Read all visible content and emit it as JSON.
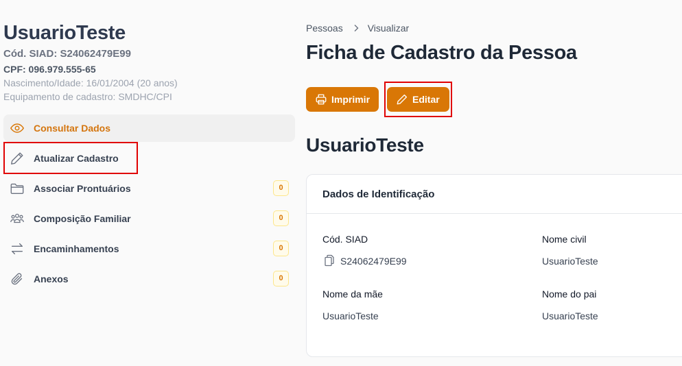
{
  "person": {
    "name": "UsuarioTeste",
    "siad": "Cód. SIAD: S24062479E99",
    "cpf": "CPF: 096.979.555-65",
    "birth": "Nascimento/Idade: 16/01/2004 (20 anos)",
    "equipment": "Equipamento de cadastro: SMDHC/CPI"
  },
  "menu": [
    {
      "label": "Consultar Dados",
      "icon": "eye-icon",
      "active": true
    },
    {
      "label": "Atualizar Cadastro",
      "icon": "pencil-icon"
    },
    {
      "label": "Associar Prontuários",
      "icon": "folder-icon",
      "count": "0"
    },
    {
      "label": "Composição Familiar",
      "icon": "users-icon",
      "count": "0"
    },
    {
      "label": "Encaminhamentos",
      "icon": "arrows-swap-icon",
      "count": "0"
    },
    {
      "label": "Anexos",
      "icon": "paperclip-icon",
      "count": "0"
    }
  ],
  "breadcrumb": {
    "root": "Pessoas",
    "current": "Visualizar"
  },
  "page": {
    "title": "Ficha de Cadastro da Pessoa",
    "print_label": "Imprimir",
    "edit_label": "Editar",
    "person_name": "UsuarioTeste"
  },
  "card": {
    "title": "Dados de Identificação",
    "fields": [
      {
        "label": "Cód. SIAD",
        "value": "S24062479E99"
      },
      {
        "label": "Nome civil",
        "value": "UsuarioTeste"
      },
      {
        "label": "Nome da mãe",
        "value": "UsuarioTeste"
      },
      {
        "label": "Nome do pai",
        "value": "UsuarioTeste"
      }
    ]
  },
  "colors": {
    "accent": "#d97706",
    "active_text": "#d4750e",
    "highlight": "#e00000"
  }
}
